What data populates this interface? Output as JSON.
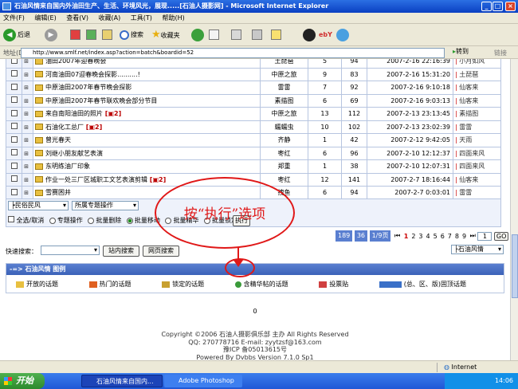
{
  "window": {
    "title": "石油风情来自国内外油田生产、生活、环境风光，展现.....[石油人摄影网] - Microsoft Internet Explorer",
    "minimize": "_",
    "maximize": "□",
    "close": "×"
  },
  "menu": [
    "文件(F)",
    "编辑(E)",
    "查看(V)",
    "收藏(A)",
    "工具(T)",
    "帮助(H)"
  ],
  "toolbar": {
    "back": "后退",
    "search": "搜索",
    "favorites": "收藏夹",
    "go_arrow": "▸"
  },
  "address": {
    "label": "地址(D)",
    "url": "http://www.smlf.net/index.asp?action=batch&boardid=52",
    "go": "转到",
    "links": "链接"
  },
  "topics": [
    {
      "title": "油田2007年迎春晚会",
      "pages": "",
      "author": "土琵琶",
      "replies": "5",
      "views": "94",
      "date": "2007-2-16 22:16:39",
      "last": "小月如风"
    },
    {
      "title": "河南油田07迎春晚会探影..........!",
      "pages": "",
      "author": "中原之旅",
      "replies": "9",
      "views": "83",
      "date": "2007-2-16 15:31:20",
      "last": "土琵琶"
    },
    {
      "title": "中原油田2007年春节晚会探影",
      "pages": "",
      "author": "雷雷",
      "replies": "7",
      "views": "92",
      "date": "2007-2-16 9:10:18",
      "last": "仙客来"
    },
    {
      "title": "中原油田2007年春节联欢晚会部分节目",
      "pages": "",
      "author": "素描图",
      "replies": "6",
      "views": "69",
      "date": "2007-2-16 9:03:13",
      "last": "仙客来"
    },
    {
      "title": "来自南阳油田的照片",
      "pages": "2",
      "author": "中原之旅",
      "replies": "13",
      "views": "112",
      "date": "2007-2-13 23:13:45",
      "last": "素描图"
    },
    {
      "title": "石油化工总厂",
      "pages": "2",
      "author": "蠕蠕虫",
      "replies": "10",
      "views": "102",
      "date": "2007-2-13 23:02:39",
      "last": "雷雷"
    },
    {
      "title": "曾光春天",
      "pages": "",
      "author": "齐静",
      "replies": "1",
      "views": "42",
      "date": "2007-2-12 9:42:05",
      "last": "天雨"
    },
    {
      "title": "刘继小朋友献艺表演",
      "pages": "",
      "author": "枣红",
      "replies": "6",
      "views": "96",
      "date": "2007-2-10 12:12:37",
      "last": "四面来风"
    },
    {
      "title": "东明练油厂印象",
      "pages": "",
      "author": "郑重",
      "replies": "1",
      "views": "38",
      "date": "2007-2-10 12:07:31",
      "last": "四面来风"
    },
    {
      "title": "作业一处三厂区城职工文艺表演剪辑",
      "pages": "2",
      "author": "枣红",
      "replies": "12",
      "views": "141",
      "date": "2007-2-7 18:16:44",
      "last": "仙客来"
    },
    {
      "title": "雪赛困井",
      "pages": "",
      "author": "拽鱼",
      "replies": "6",
      "views": "94",
      "date": "2007-2-7 0:03:01",
      "last": "雷雷"
    }
  ],
  "batch": {
    "select1": "┝民俗民风",
    "select2": "所属专题操作",
    "select_all": "全选/取消",
    "opt1": "专题操作",
    "opt2": "批量删除",
    "opt3": "批量移动",
    "opt4": "批量精华",
    "opt5": "批量锁定",
    "execute": "执行"
  },
  "pager": {
    "total": "189",
    "per": "36",
    "pages": "1/9页",
    "first": "⏮",
    "nums": [
      "1",
      "2",
      "3",
      "4",
      "5",
      "6",
      "7",
      "8",
      "9"
    ],
    "last": "⏭",
    "current": "1",
    "go": "GO",
    "jump": "├石油风情"
  },
  "search": {
    "label": "快速搜索：",
    "site_btn": "站内搜索",
    "web_btn": "网页搜索"
  },
  "legend": {
    "title": "-=> 石油风情 图例",
    "items": [
      "开放的话题",
      "热门的话题",
      "锁定的话题",
      "含精华帖的话题",
      "投票贴",
      "(总、区、版)固顶话题"
    ]
  },
  "annotation": "按“执行”选项",
  "zero": "0",
  "footer": [
    "Copyright ©2006 石油人摄影俱乐部 主办 All Rights Reserved",
    "QQ: 270778716 E-mail: zyytzsf@163.com",
    "豫ICP 备05013615号",
    "Powered By Dvbbs Version 7.1.0 Sp1"
  ],
  "status": {
    "text": "",
    "zone": "Internet"
  },
  "taskbar": {
    "start": "开始",
    "task1": "石油风情来自国内...",
    "task2": "Adobe Photoshop",
    "clock": "14:06"
  },
  "colors": {
    "title_blue": "#0a3fc2",
    "page_red": "#b00000",
    "annotation_red": "#e01818"
  }
}
